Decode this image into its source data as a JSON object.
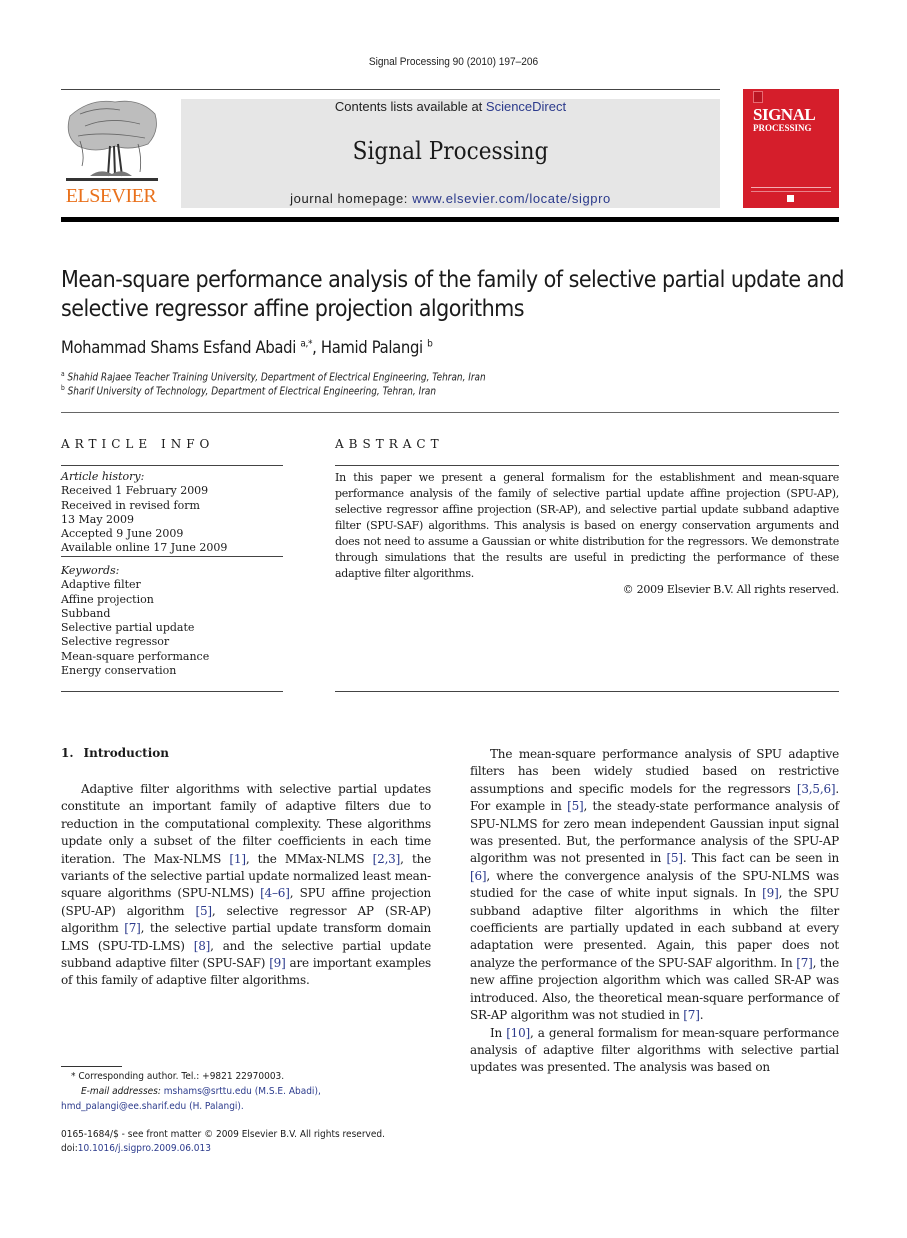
{
  "running_head": "Signal Processing 90 (2010) 197–206",
  "header": {
    "publisher_logo_text": "ELSEVIER",
    "contents_prefix": "Contents lists available at ",
    "contents_link": "ScienceDirect",
    "journal_title": "Signal Processing",
    "homepage_prefix": "journal homepage: ",
    "homepage_link": "www.elsevier.com/locate/sigpro",
    "cover": {
      "line1": "SIGNAL",
      "line2": "PROCESSING",
      "color": "#d51e2b"
    }
  },
  "article": {
    "title": "Mean-square performance analysis of the family of selective partial update and selective regressor affine projection algorithms",
    "authors": [
      {
        "name": "Mohammad Shams Esfand Abadi",
        "marks": "a,*"
      },
      {
        "name": "Hamid Palangi",
        "marks": "b"
      }
    ],
    "author_separator": ", ",
    "affiliations": [
      {
        "mark": "a",
        "text": "Shahid Rajaee Teacher Training University, Department of Electrical Engineering, Tehran, Iran"
      },
      {
        "mark": "b",
        "text": "Sharif University of Technology, Department of Electrical Engineering, Tehran, Iran"
      }
    ]
  },
  "article_info": {
    "heading": "ARTICLE INFO",
    "history_label": "Article history:",
    "history": [
      "Received 1 February 2009",
      "Received in revised form",
      "13 May 2009",
      "Accepted 9 June 2009",
      "Available online 17 June 2009"
    ],
    "keywords_label": "Keywords:",
    "keywords": [
      "Adaptive filter",
      "Affine projection",
      "Subband",
      "Selective partial update",
      "Selective regressor",
      "Mean-square performance",
      "Energy conservation"
    ]
  },
  "abstract": {
    "heading": "ABSTRACT",
    "text": "In this paper we present a general formalism for the establishment and mean-square performance analysis of the family of selective partial update affine projection (SPU-AP), selective regressor affine projection (SR-AP), and selective partial update subband adaptive filter (SPU-SAF) algorithms. This analysis is based on energy conservation arguments and does not need to assume a Gaussian or white distribution for the regressors. We demonstrate through simulations that the results are useful in predicting the performance of these adaptive filter algorithms.",
    "copyright": "© 2009 Elsevier B.V. All rights reserved."
  },
  "introduction": {
    "number": "1.",
    "heading": "Introduction",
    "left_paragraph": [
      {
        "t": "Adaptive filter algorithms with selective partial updates constitute an important family of adaptive filters due to reduction in the computational complexity. These algorithms update only a subset of the filter coefficients in each time iteration. The Max-NLMS "
      },
      {
        "ref": "[1]"
      },
      {
        "t": ", the MMax-NLMS "
      },
      {
        "ref": "[2,3]"
      },
      {
        "t": ", the variants of the selective partial update normalized least mean-square algorithms (SPU-NLMS) "
      },
      {
        "ref": "[4–6]"
      },
      {
        "t": ", SPU affine projection (SPU-AP) algorithm "
      },
      {
        "ref": "[5]"
      },
      {
        "t": ", selective regressor AP (SR-AP) algorithm "
      },
      {
        "ref": "[7]"
      },
      {
        "t": ", the selective partial update transform domain LMS (SPU-TD-LMS) "
      },
      {
        "ref": "[8]"
      },
      {
        "t": ", and the selective partial update subband adaptive filter (SPU-SAF) "
      },
      {
        "ref": "[9]"
      },
      {
        "t": " are important examples of this family of adaptive filter algorithms."
      }
    ],
    "right_paragraph_1": [
      {
        "t": "The mean-square performance analysis of SPU adaptive filters has been widely studied based on restrictive assumptions and specific models for the regressors "
      },
      {
        "ref": "[3,5,6]"
      },
      {
        "t": ". For example in "
      },
      {
        "ref": "[5]"
      },
      {
        "t": ", the steady-state performance analysis of SPU-NLMS for zero mean independent Gaussian input signal was presented. But, the performance analysis of the SPU-AP algorithm was not presented in "
      },
      {
        "ref": "[5]"
      },
      {
        "t": ". This fact can be seen in "
      },
      {
        "ref": "[6]"
      },
      {
        "t": ", where the convergence analysis of the SPU-NLMS was studied for the case of white input signals. In "
      },
      {
        "ref": "[9]"
      },
      {
        "t": ", the SPU subband adaptive filter algorithms in which the filter coefficients are partially updated in each subband at every adaptation were presented. Again, this paper does not analyze the performance of the SPU-SAF algorithm. In "
      },
      {
        "ref": "[7]"
      },
      {
        "t": ", the new affine projection algorithm which was called SR-AP was introduced. Also, the theoretical mean-square performance of SR-AP algorithm was not studied in "
      },
      {
        "ref": "[7]"
      },
      {
        "t": "."
      }
    ],
    "right_paragraph_2": [
      {
        "t": "In "
      },
      {
        "ref": "[10]"
      },
      {
        "t": ", a general formalism for mean-square performance analysis of adaptive filter algorithms with selective partial updates was presented. The analysis was based on"
      }
    ]
  },
  "footnotes": {
    "corresponding": "* Corresponding author. Tel.: +9821 22970003.",
    "email_label": "E-mail addresses: ",
    "email_1": "mshams@srttu.edu",
    "email_1_owner": " (M.S.E. Abadi),",
    "email_2": "hmd_palangi@ee.sharif.edu",
    "email_2_owner": " (H. Palangi).",
    "front_matter": "0165-1684/$ - see front matter © 2009 Elsevier B.V. All rights reserved.",
    "doi_prefix": "doi:",
    "doi": "10.1016/j.sigpro.2009.06.013"
  },
  "colors": {
    "link": "#2b3a8c",
    "elsevier_orange": "#e9711c",
    "banner_gray": "#e6e6e6"
  }
}
